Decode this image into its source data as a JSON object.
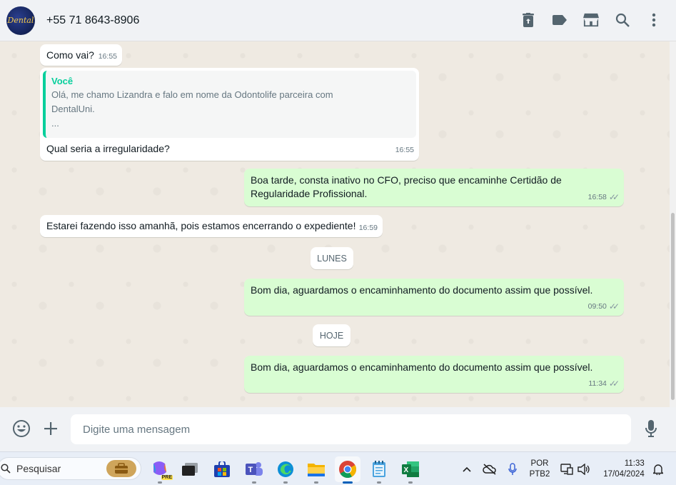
{
  "header": {
    "avatar_text": "Dental",
    "contact_name": "+55 71 8643-8906",
    "icons": [
      "delete-icon",
      "label-icon",
      "catalog-icon",
      "search-icon",
      "menu-icon"
    ]
  },
  "messages": [
    {
      "text": "Como vai?",
      "time": "16:55",
      "direction": "in"
    },
    {
      "quote_author": "Você",
      "quote_line1": "Olá, me chamo Lizandra e falo em nome da Odontolife parceira com",
      "quote_line2": "DentalUni.",
      "quote_line3": "...",
      "text": "Qual seria a irregularidade?",
      "time": "16:55",
      "direction": "in"
    },
    {
      "text_line1": "Boa tarde, consta inativo no CFO, preciso que encaminhe Certidão de",
      "text_line2": "Regularidade Profissional.",
      "time": "16:58",
      "direction": "out"
    },
    {
      "text": "Estarei fazendo isso amanhã, pois estamos encerrando o expediente!",
      "time": "16:59",
      "direction": "in"
    },
    {
      "text": "Bom dia, aguardamos o encaminhamento do documento assim que possível.",
      "time": "09:50",
      "direction": "out"
    },
    {
      "text": "Bom dia, aguardamos o encaminhamento do documento assim que possível.",
      "time": "11:34",
      "direction": "out"
    }
  ],
  "date_separators": [
    "LUNES",
    "HOJE"
  ],
  "composer": {
    "placeholder": "Digite uma mensagem",
    "icons": [
      "emoji-icon",
      "attach-plus-icon",
      "microphone-icon"
    ]
  },
  "taskbar": {
    "search_label": "Pesquisar",
    "copilot_badge": "PRE",
    "apps": [
      "copilot-icon",
      "task-view-icon",
      "store-icon",
      "teams-icon",
      "edge-icon",
      "file-explorer-icon",
      "chrome-icon",
      "notepad-icon",
      "excel-icon"
    ],
    "active_app": "chrome-icon",
    "lang_line1": "POR",
    "lang_line2": "PTB2",
    "clock_time": "11:33",
    "clock_date": "17/04/2024"
  },
  "colors": {
    "incoming_bubble": "#ffffff",
    "outgoing_bubble": "#d9fdd3",
    "chat_background": "#efeae2",
    "quote_accent": "#06cf9c",
    "header_background": "#f0f2f5"
  }
}
